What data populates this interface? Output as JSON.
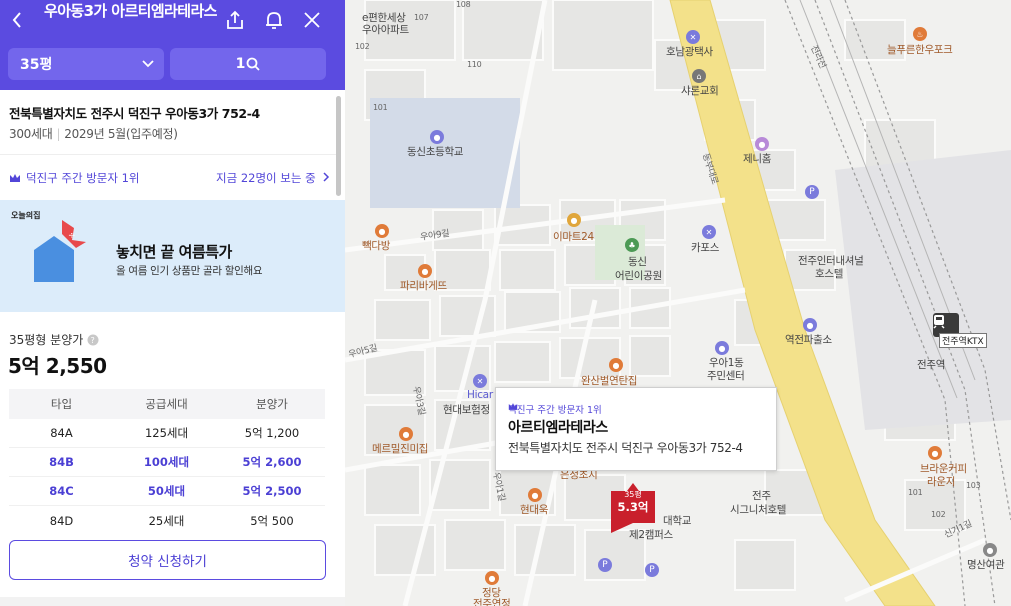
{
  "header": {
    "title": "우아동3가 아르티엠라테라스",
    "size_select": "35평",
    "count_badge": "1"
  },
  "complex": {
    "address": "전북특별자치도 전주시 덕진구 우아동3가 752-4",
    "households": "300세대",
    "move_in": "2029년 5월(입주예정)"
  },
  "ranking": {
    "label": "덕진구 주간 방문자 1위",
    "viewers": "지금 22명이 보는 중"
  },
  "banner": {
    "brand": "오늘의집",
    "main": "놓치면 끝 여름특가",
    "sub": "올 여름 인기 상품만 골라 할인해요"
  },
  "price": {
    "label": "35평형 분양가",
    "value": "5억 2,550"
  },
  "table": {
    "headers": [
      "타입",
      "공급세대",
      "분양가"
    ],
    "rows": [
      [
        "84A",
        "125세대",
        "5억 1,200"
      ],
      [
        "84B",
        "100세대",
        "5억 2,600"
      ],
      [
        "84C",
        "50세대",
        "5억 2,500"
      ],
      [
        "84D",
        "25세대",
        "5억 500"
      ]
    ]
  },
  "apply_button": "청약 신청하기",
  "map": {
    "labels": {
      "e편한세상": "e편한세상",
      "우아아파트": "우아아파트",
      "호남광택사": "호남광택사",
      "샤론교회": "샤론교회",
      "늘푸른한우포크": "늘푸른한우포크",
      "동신초등학교": "동신초등학교",
      "제니홈": "제니홈",
      "이마트24": "이마트24",
      "카포스": "카포스",
      "동신": "동신",
      "어린이공원": "어린이공원",
      "전주인터내셔널": "전주인터내셔널",
      "호스텔": "호스텔",
      "빽다방": "빽다방",
      "파리바게뜨": "파리바게뜨",
      "역전파출소": "역전파출소",
      "전주역KTX": "전주역KTX",
      "전주역": "전주역",
      "우아1동": "우아1동",
      "주민센터": "주민센터",
      "완산벌연탄집": "완산벌연탄집",
      "Hicar": "Hicar",
      "현대보험정": "현대보험정",
      "메르밀진미집": "메르밀진미집",
      "은정초지": "은정초지",
      "현대욱": "현대욱",
      "전주": "전주",
      "시그니처호텔": "시그니처호텔",
      "대학교": "대학교",
      "제2캠퍼스": "제2캠퍼스",
      "브라운커피": "브라운커피",
      "라운지": "라운지",
      "명산여관": "명산여관",
      "정당": "정당",
      "전주연정": "전주연정",
      "동부대로": "동부대로",
      "우아9길": "우아9길",
      "우아5길": "우아5길",
      "우아3길": "우아3길",
      "우아1길": "우아1길",
      "신기1길": "신기1길",
      "전라선": "전라선",
      "n108": "108",
      "n107": "107",
      "n102": "102",
      "n110": "110",
      "n101": "101",
      "n101b": "101",
      "n103": "103",
      "n102b": "102"
    },
    "popup": {
      "rank": "덕진구 주간 방문자 1위",
      "name": "아르티엠라테라스",
      "address": "전북특별자치도 전주시 덕진구 우아동3가 752-4"
    },
    "marker": {
      "size": "35평",
      "price": "5.3억"
    }
  },
  "colors": {
    "brand": "#5b4be0",
    "accent_text": "#4b3fd4",
    "marker": "#c9202c",
    "banner_bg": "#dcecfa",
    "road_main": "#f3e18a"
  }
}
